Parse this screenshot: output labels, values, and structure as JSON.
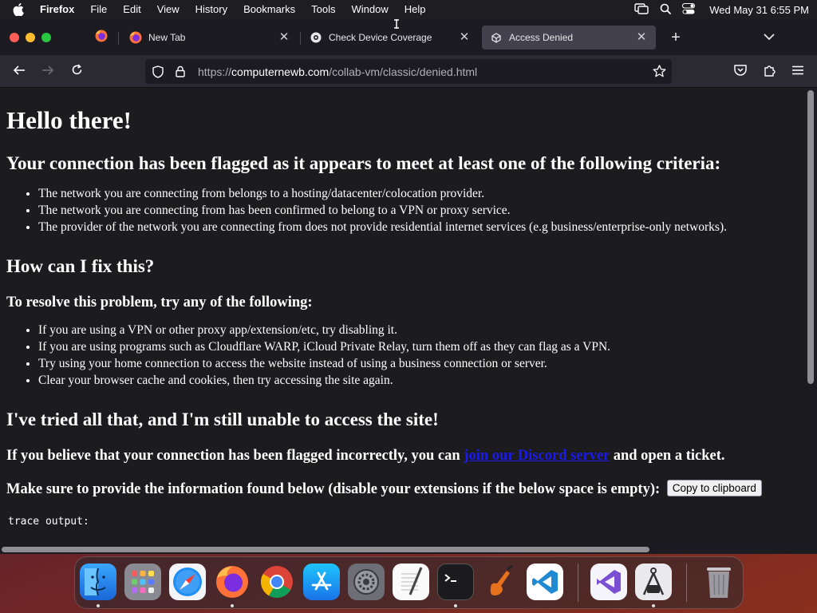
{
  "menubar": {
    "app_name": "Firefox",
    "items": [
      "File",
      "Edit",
      "View",
      "History",
      "Bookmarks",
      "Tools",
      "Window",
      "Help"
    ],
    "clock": "Wed May 31  6:55 PM"
  },
  "tabs": [
    {
      "title": "New Tab",
      "icon": "firefox-icon"
    },
    {
      "title": "Check Device Coverage",
      "icon": "site-icon"
    },
    {
      "title": "Access Denied",
      "icon": "site-icon",
      "active": true
    }
  ],
  "address_bar": {
    "url_scheme": "https://",
    "url_host": "computernewb.com",
    "url_path": "/collab-vm/classic/denied.html"
  },
  "page": {
    "heading": "Hello there!",
    "flagged_heading": "Your connection has been flagged as it appears to meet at least one of the following criteria:",
    "criteria": [
      "The network you are connecting from belongs to a hosting/datacenter/colocation provider.",
      "The network you are connecting from has been confirmed to belong to a VPN or proxy service.",
      "The provider of the network you are connecting from does not provide residential internet services (e.g business/enterprise-only networks)."
    ],
    "fix_heading": "How can I fix this?",
    "resolve_heading": "To resolve this problem, try any of the following:",
    "fixes": [
      "If you are using a VPN or other proxy app/extension/etc, try disabling it.",
      "If you are using programs such as Cloudflare WARP, iCloud Private Relay, turn them off as they can flag as a VPN.",
      "Try using your home connection to access the website instead of using a business connection or server.",
      "Clear your browser cache and cookies, then try accessing the site again."
    ],
    "tried_heading": "I've tried all that, and I'm still unable to access the site!",
    "incorrect_prefix": "If you believe that your connection has been flagged incorrectly, you can ",
    "discord_link": "join our Discord server",
    "incorrect_suffix": " and open a ticket.",
    "info_text": "Make sure to provide the information found below (disable your extensions if the below space is empty):",
    "copy_button": "Copy to clipboard",
    "trace_label": "trace output:"
  },
  "dock": {
    "items": [
      "finder-icon",
      "launchpad-icon",
      "safari-icon",
      "firefox-icon",
      "chrome-icon",
      "app-store-icon",
      "system-settings-icon",
      "textedit-icon",
      "terminal-icon",
      "garageband-icon",
      "vscode-icon",
      "visual-studio-icon",
      "instruments-icon",
      "trash-icon"
    ]
  }
}
